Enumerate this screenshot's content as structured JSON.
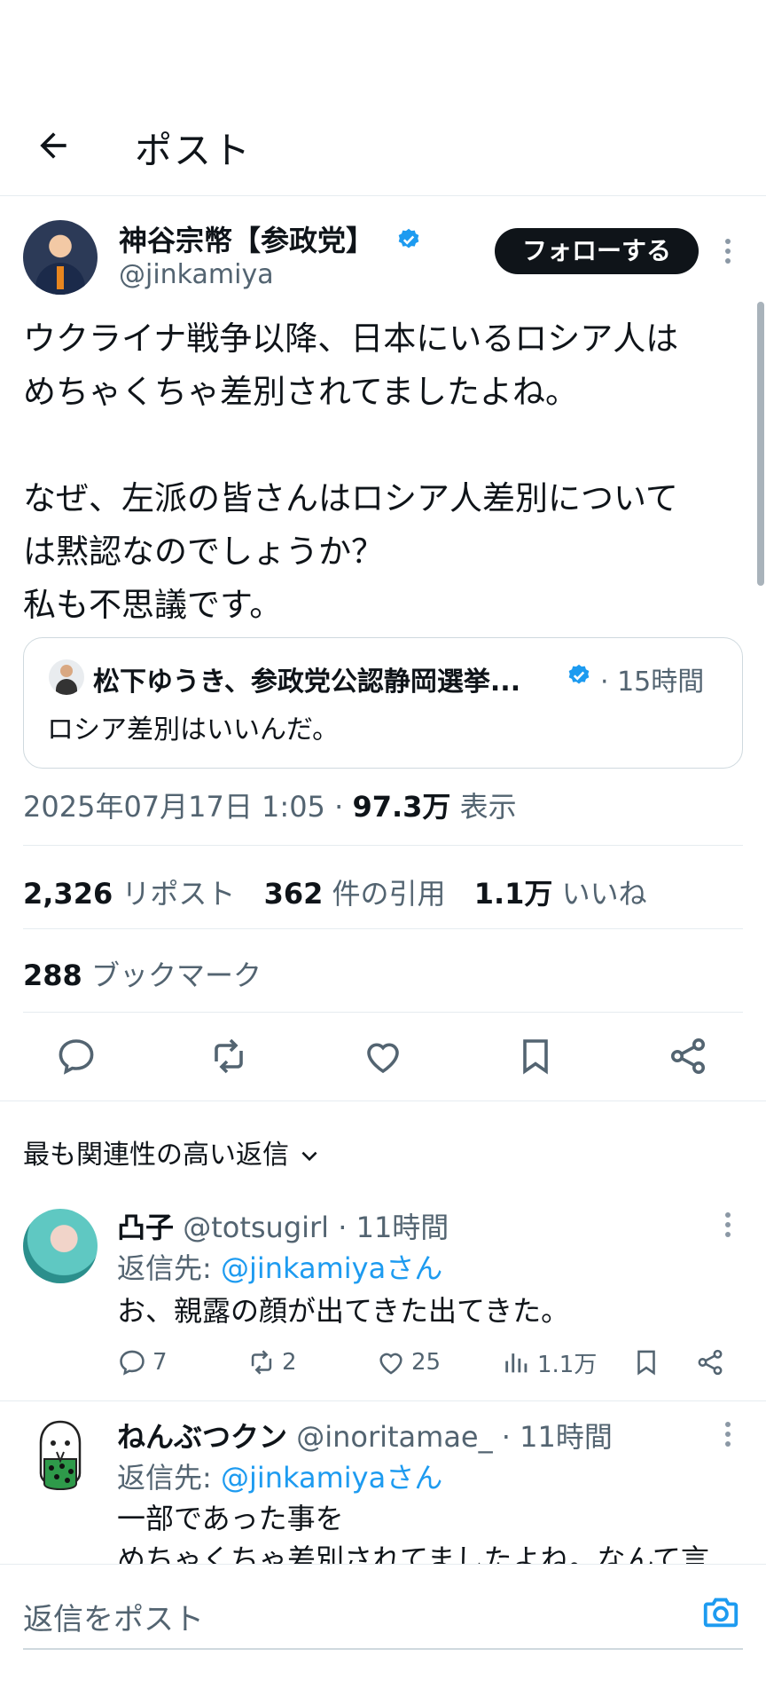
{
  "header": {
    "title": "ポスト"
  },
  "post": {
    "author_name": "神谷宗幣【参政党】",
    "author_handle": "@jinkamiya",
    "follow_label": "フォローする",
    "body": "ウクライナ戦争以降、日本にいるロシア人は\nめちゃくちゃ差別されてましたよね。\n\nなぜ、左派の皆さんはロシア人差別について\nは黙認なのでしょうか？\n私も不思議です。",
    "quote": {
      "name": "松下ゆうき、参政党公認静岡選挙...",
      "time": "· 15時間",
      "text": "ロシア差別はいいんだ。"
    },
    "datetime": "2025年07月17日 1:05 · ",
    "views_value": "97.3万",
    "views_label": " 表示",
    "reposts_value": "2,326",
    "reposts_label": " リポスト",
    "quotes_value": "362",
    "quotes_label": " 件の引用",
    "likes_value": "1.1万",
    "likes_label": " いいね",
    "bookmarks_value": "288",
    "bookmarks_label": " ブックマーク"
  },
  "replies_sort": {
    "label": "最も関連性の高い返信"
  },
  "replies": [
    {
      "name": "凸子",
      "handle": " @totsugirl",
      "time": " · 11時間",
      "reply_to_prefix": "返信先: ",
      "reply_to": "@jinkamiyaさん",
      "text": "お、親露の顔が出てきた出てきた。",
      "comments": "7",
      "reposts": "2",
      "likes": "25",
      "views": "1.1万"
    },
    {
      "name": "ねんぶつクン",
      "handle": " @inoritamae_",
      "time": " · 11時間",
      "reply_to_prefix": "返信先: ",
      "reply_to": "@jinkamiyaさん",
      "text": "一部であった事を\nめちゃくちゃ差別されてましたよね。なんて言"
    }
  ],
  "compose": {
    "placeholder": "返信をポスト"
  },
  "colors": {
    "accent": "#1d9bf0",
    "text": "#0f1419",
    "muted": "#536471"
  },
  "icons": [
    "back-arrow-icon",
    "verified-badge-icon",
    "more-icon",
    "reply-icon",
    "repost-icon",
    "like-icon",
    "bookmark-icon",
    "share-icon",
    "views-icon",
    "chevron-down-icon",
    "camera-icon"
  ]
}
